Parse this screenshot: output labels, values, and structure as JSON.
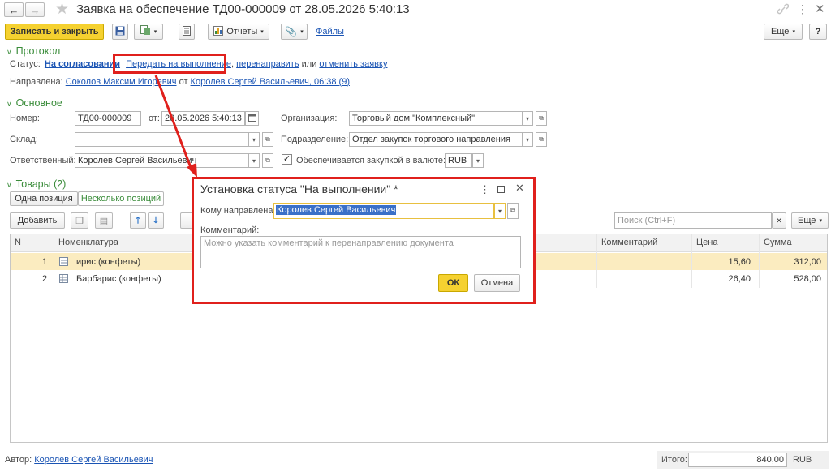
{
  "window": {
    "title": "Заявка на обеспечение ТД00-000009 от 28.05.2026 5:40:13"
  },
  "toolbar": {
    "save_close": "Записать и закрыть",
    "reports": "Отчеты",
    "files": "Файлы",
    "more": "Еще",
    "help": "?"
  },
  "protocol": {
    "section": "Протокол",
    "status_label": "Статус:",
    "status_value": "На согласовании",
    "action_execute": "Передать на выполнение",
    "comma": ",",
    "action_redirect": "перенаправить",
    "or_text": "или",
    "action_cancel": "отменить заявку",
    "directed_label": "Направлена:",
    "directed_from": "Соколов Максим Игоревич",
    "to_text": "от",
    "directed_by": "Королев Сергей Васильевич, 06:38 (9)"
  },
  "main": {
    "section": "Основное",
    "number_label": "Номер:",
    "number_value": "ТД00-000009",
    "date_label": "от:",
    "date_value": "28.05.2026  5:40:13",
    "org_label": "Организация:",
    "org_value": "Торговый дом \"Комплексный\"",
    "warehouse_label": "Склад:",
    "warehouse_value": "",
    "dept_label": "Подразделение:",
    "dept_value": "Отдел закупок торгового направления",
    "responsible_label": "Ответственный:",
    "responsible_value": "Королев Сергей Васильевич",
    "currency_check_label": "Обеспечивается закупкой в валюте:",
    "currency_value": "RUB"
  },
  "goods": {
    "section": "Товары (2)",
    "tab_single": "Одна позиция",
    "tab_multi": "Несколько позиций",
    "add": "Добавить",
    "search_placeholder": "Поиск (Ctrl+F)",
    "more": "Еще",
    "columns": {
      "n": "N",
      "nomenclature": "Номенклатура",
      "comment": "Комментарий",
      "price": "Цена",
      "sum": "Сумма"
    },
    "rows": [
      {
        "n": "1",
        "name": "ирис (конфеты)",
        "price": "15,60",
        "sum": "312,00"
      },
      {
        "n": "2",
        "name": "Барбарис (конфеты)",
        "price": "26,40",
        "sum": "528,00"
      }
    ]
  },
  "footer": {
    "author_label": "Автор:",
    "author_value": "Королев Сергей Васильевич",
    "total_label": "Итого:",
    "total_value": "840,00",
    "currency": "RUB"
  },
  "dialog": {
    "title": "Установка статуса \"На выполнении\" *",
    "to_label": "Кому направлена:",
    "to_value": "Королев Сергей Васильевич",
    "comment_label": "Комментарий:",
    "comment_placeholder": "Можно указать комментарий к перенаправлению документа",
    "ok": "ОК",
    "cancel": "Отмена"
  },
  "colors": {
    "accent_yellow": "#f5d130",
    "highlight_red": "#e0201c",
    "section_green": "#3a8c3a",
    "link_blue": "#1a54b4",
    "selected_row": "#fbecc0"
  }
}
